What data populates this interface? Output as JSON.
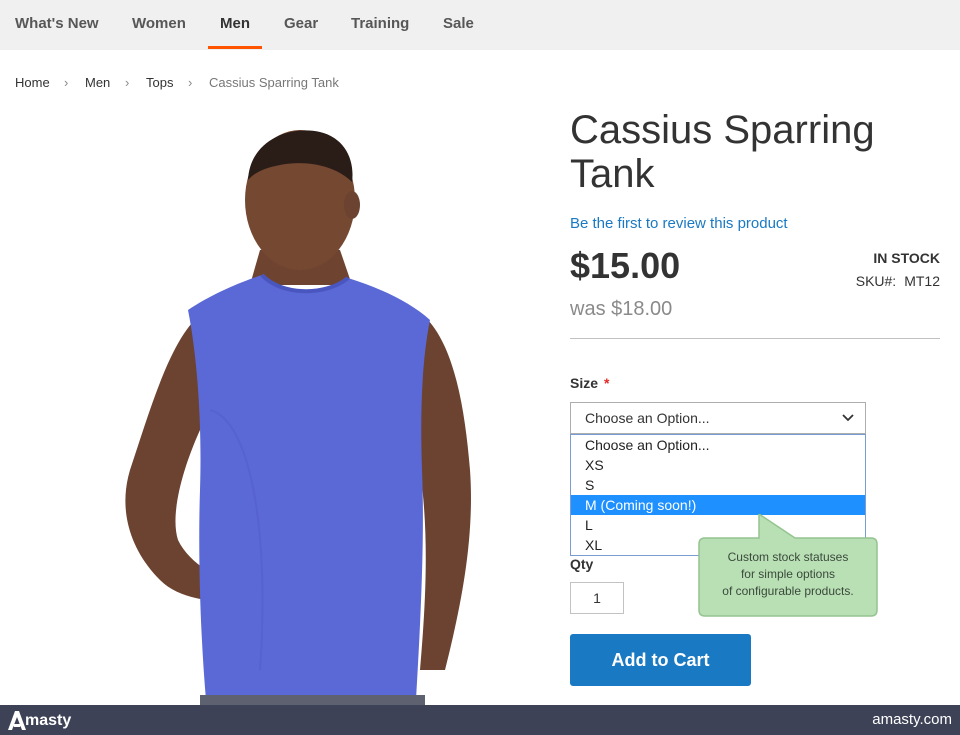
{
  "nav": {
    "items": [
      {
        "label": "What's New"
      },
      {
        "label": "Women"
      },
      {
        "label": "Men"
      },
      {
        "label": "Gear"
      },
      {
        "label": "Training"
      },
      {
        "label": "Sale"
      }
    ],
    "active": "Men",
    "accent_color": "#ff5501"
  },
  "breadcrumb": {
    "items": [
      "Home",
      "Men",
      "Tops",
      "Cassius Sparring Tank"
    ],
    "separator": "›"
  },
  "product": {
    "title_line1": "Cassius Sparring",
    "title_line2": "Tank",
    "review_link": "Be the first to review this product",
    "price": "$15.00",
    "old_price": "was $18.00",
    "stock_status": "In stock",
    "sku_label": "SKU#:",
    "sku_value": "MT12",
    "image_icon": "model-in-blue-tank-top-photo"
  },
  "options": {
    "size_label": "Size",
    "required_marker": "*",
    "select_value": "Choose an Option...",
    "dropdown_items": [
      "Choose an Option...",
      "XS",
      "S",
      "M (Coming soon!)",
      "L",
      "XL"
    ],
    "highlighted_item": "M (Coming soon!)"
  },
  "qty": {
    "label": "Qty",
    "value": "1"
  },
  "add_to_cart_label": "Add to Cart",
  "callout": {
    "lines": [
      "Custom stock statuses",
      "for simple options",
      "of configurable products."
    ]
  },
  "footer": {
    "logo_text": "masty",
    "logo_icon": "amasty-a-logo-icon",
    "url": "amasty.com"
  },
  "colors": {
    "link_blue": "#1979c3",
    "button_blue": "#1979c3",
    "highlight_blue": "#1e90ff",
    "required_red": "#e02b27",
    "callout_green": "#b9dfb5",
    "footer_bg": "#3d4256"
  }
}
